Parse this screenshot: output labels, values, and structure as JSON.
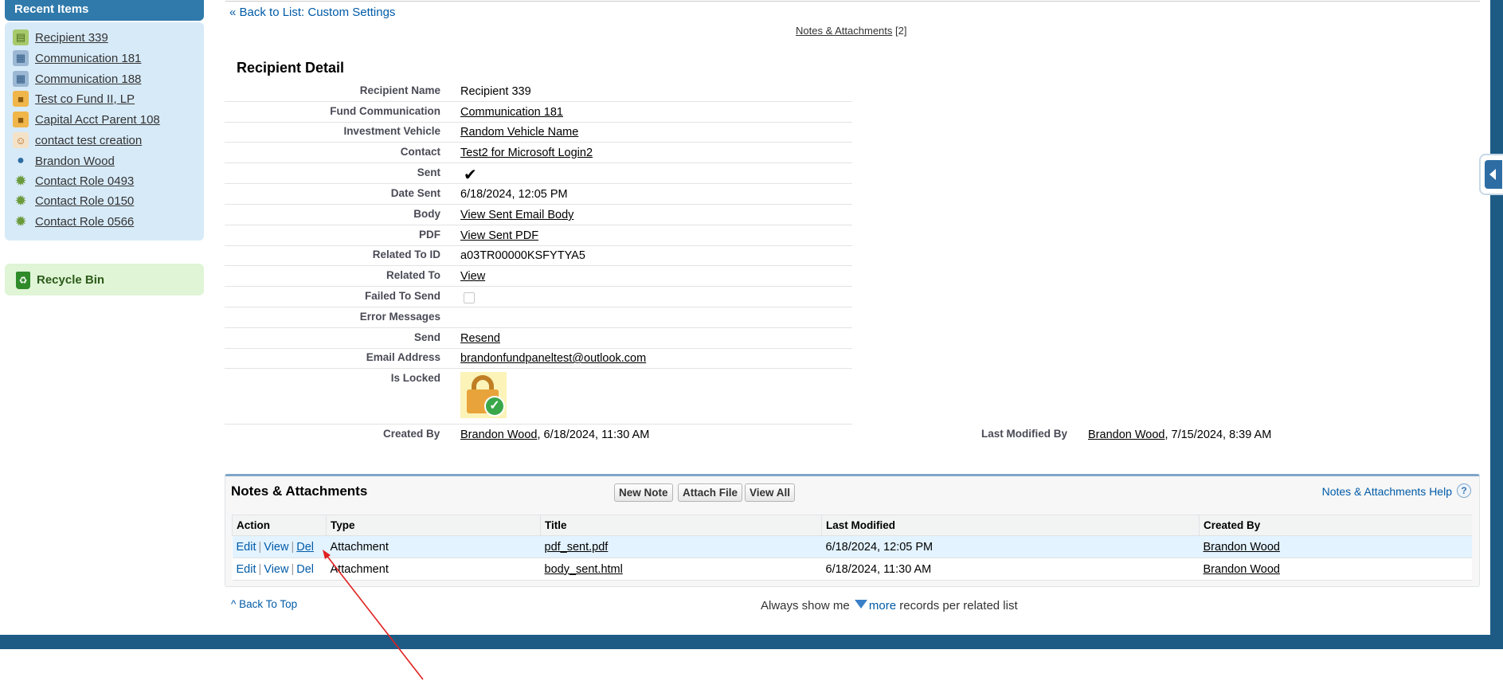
{
  "sidebar": {
    "recent_title": "Recent Items",
    "recent_items": [
      {
        "label": "Recipient 339",
        "icon": "custom-object-icon"
      },
      {
        "label": "Communication 181",
        "icon": "communication-icon"
      },
      {
        "label": "Communication 188",
        "icon": "communication-icon"
      },
      {
        "label": "Test co Fund II, LP",
        "icon": "fund-box-icon"
      },
      {
        "label": "Capital Acct Parent 108",
        "icon": "fund-box-icon"
      },
      {
        "label": "contact test creation",
        "icon": "contact-icon"
      },
      {
        "label": "Brandon Wood",
        "icon": "user-icon"
      },
      {
        "label": "Contact Role 0493",
        "icon": "gear-icon"
      },
      {
        "label": "Contact Role 0150",
        "icon": "gear-icon"
      },
      {
        "label": "Contact Role 0566",
        "icon": "gear-icon"
      }
    ],
    "recycle_label": "Recycle Bin"
  },
  "nav": {
    "back_prefix": "«",
    "back_link": "Back to List: Custom Settings",
    "notes_link": "Notes & Attachments",
    "notes_count": "[2]"
  },
  "detail": {
    "title": "Recipient Detail",
    "fields": {
      "recipient_name": {
        "label": "Recipient Name",
        "value": "Recipient 339"
      },
      "fund_communication": {
        "label": "Fund Communication",
        "value": "Communication 181"
      },
      "investment_vehicle": {
        "label": "Investment Vehicle",
        "value": "Random Vehicle Name"
      },
      "contact": {
        "label": "Contact",
        "value": "Test2 for Microsoft Login2"
      },
      "sent": {
        "label": "Sent",
        "value": "✔"
      },
      "date_sent": {
        "label": "Date Sent",
        "value": "6/18/2024, 12:05 PM"
      },
      "body": {
        "label": "Body",
        "value": "View Sent Email Body"
      },
      "pdf": {
        "label": "PDF",
        "value": "View Sent PDF"
      },
      "related_to_id": {
        "label": "Related To ID",
        "value": "a03TR00000KSFYTYA5"
      },
      "related_to": {
        "label": "Related To",
        "value": "View"
      },
      "failed_to_send": {
        "label": "Failed To Send"
      },
      "error_messages": {
        "label": "Error Messages",
        "value": ""
      },
      "send": {
        "label": "Send",
        "value": "Resend"
      },
      "email_address": {
        "label": "Email Address",
        "value": "brandonfundpaneltest@outlook.com"
      },
      "is_locked": {
        "label": "Is Locked"
      }
    },
    "created_by": {
      "label": "Created By",
      "name": "Brandon Wood",
      "date": ", 6/18/2024, 11:30 AM"
    },
    "last_modified_by": {
      "label": "Last Modified By",
      "name": "Brandon Wood",
      "date": ", 7/15/2024, 8:39 AM"
    }
  },
  "related_list": {
    "title": "Notes & Attachments",
    "buttons": {
      "new_note": "New Note",
      "attach_file": "Attach File",
      "view_all": "View All"
    },
    "help": "Notes & Attachments Help",
    "help_icon": "?",
    "columns": [
      "Action",
      "Type",
      "Title",
      "Last Modified",
      "Created By"
    ],
    "actions": {
      "edit": "Edit",
      "view": "View",
      "del": "Del",
      "sep": "|"
    },
    "rows": [
      {
        "type": "Attachment",
        "title": "pdf_sent.pdf",
        "last_modified": "6/18/2024, 12:05 PM",
        "created_by": "Brandon Wood"
      },
      {
        "type": "Attachment",
        "title": "body_sent.html",
        "last_modified": "6/18/2024, 11:30 AM",
        "created_by": "Brandon Wood"
      }
    ]
  },
  "footer": {
    "back_to_top": "Back To Top",
    "back_to_top_icon": "^",
    "always_prefix": "Always show me",
    "more": "more",
    "always_suffix": "records per related list"
  },
  "colors": {
    "frame": "#1d5b85",
    "link": "#015ba7",
    "sidebar_bg": "#d7eaf8",
    "annotation_arrow": "#e02020"
  }
}
